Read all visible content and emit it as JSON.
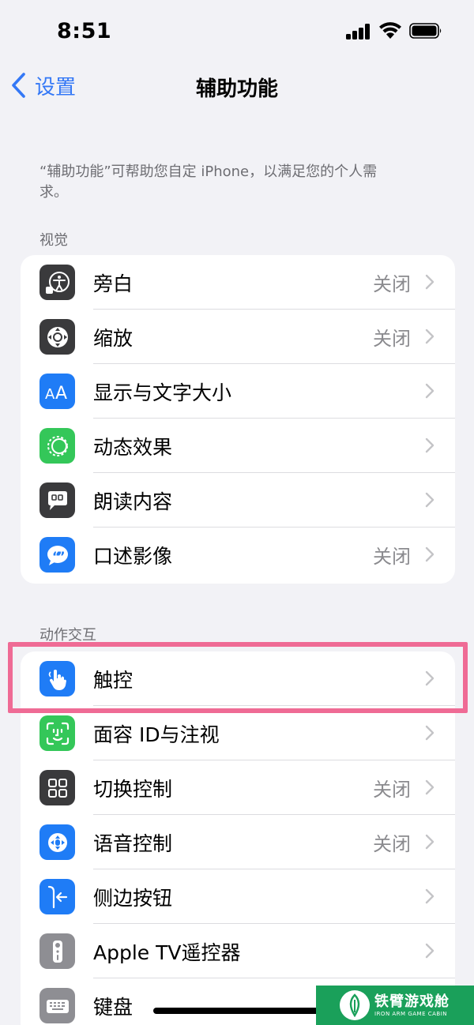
{
  "status_bar": {
    "time": "8:51"
  },
  "nav": {
    "back_label": "设置",
    "title": "辅助功能"
  },
  "description": "“辅助功能”可帮助您自定 iPhone，以满足您的个人需求。",
  "sections": [
    {
      "header": "视觉",
      "items": [
        {
          "label": "旁白",
          "value": "关闭",
          "icon": "voiceover-icon",
          "color": "#3a3a3c"
        },
        {
          "label": "缩放",
          "value": "关闭",
          "icon": "zoom-icon",
          "color": "#3a3a3c"
        },
        {
          "label": "显示与文字大小",
          "value": "",
          "icon": "text-size-icon",
          "color": "#1f7cf6"
        },
        {
          "label": "动态效果",
          "value": "",
          "icon": "motion-icon",
          "color": "#34c759"
        },
        {
          "label": "朗读内容",
          "value": "",
          "icon": "spoken-content-icon",
          "color": "#3a3a3c"
        },
        {
          "label": "口述影像",
          "value": "关闭",
          "icon": "audio-descriptions-icon",
          "color": "#1f7cf6"
        }
      ]
    },
    {
      "header": "动作交互",
      "items": [
        {
          "label": "触控",
          "value": "",
          "icon": "touch-icon",
          "color": "#1f7cf6"
        },
        {
          "label": "面容 ID与注视",
          "value": "",
          "icon": "face-id-icon",
          "color": "#34c759"
        },
        {
          "label": "切换控制",
          "value": "关闭",
          "icon": "switch-control-icon",
          "color": "#3a3a3c"
        },
        {
          "label": "语音控制",
          "value": "关闭",
          "icon": "voice-control-icon",
          "color": "#1f7cf6"
        },
        {
          "label": "侧边按钮",
          "value": "",
          "icon": "side-button-icon",
          "color": "#1f7cf6"
        },
        {
          "label": "Apple TV遥控器",
          "value": "",
          "icon": "apple-tv-remote-icon",
          "color": "#8e8e93"
        },
        {
          "label": "键盘",
          "value": "",
          "icon": "keyboard-icon",
          "color": "#8e8e93"
        }
      ]
    }
  ],
  "highlight": {
    "target": "触控",
    "color": "#ef6b95"
  },
  "watermark": {
    "main": "铁臂游戏舱",
    "sub": "IRON ARM GAME CABIN",
    "color": "#1aa05a"
  }
}
